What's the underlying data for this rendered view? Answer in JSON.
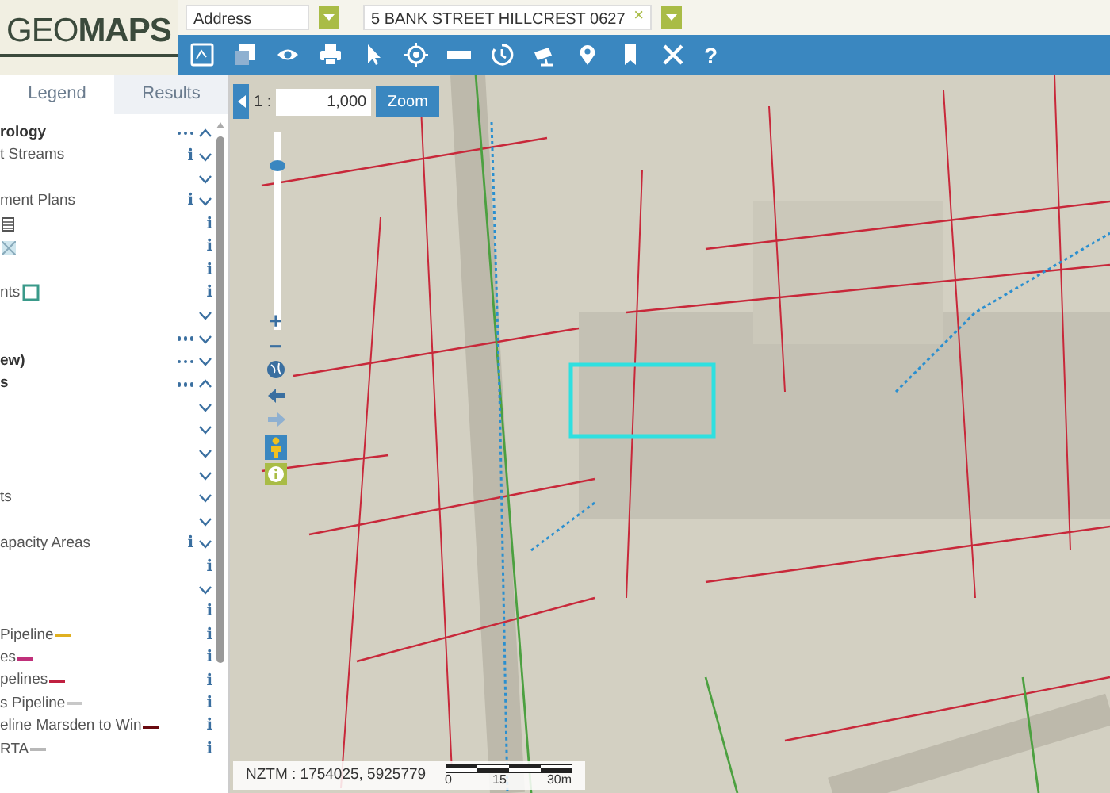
{
  "logo": "GEO**MAPS**",
  "search": {
    "type_value": "Address",
    "query": "5 BANK STREET HILLCREST 0627",
    "clear": "×"
  },
  "toolbar": {
    "help": "?"
  },
  "tabs": [
    {
      "label": "Legend",
      "selected": true
    },
    {
      "label": "Results",
      "selected": false
    }
  ],
  "legend": [
    {
      "label": "rology",
      "bold": true,
      "more": true,
      "expanded": true
    },
    {
      "label": "t Streams",
      "info": "i",
      "expanded": false
    },
    {
      "expanded": false
    },
    {
      "label": "ment Plans",
      "info": "i",
      "expanded": false
    },
    {
      "kind": "hatch",
      "info": "i"
    },
    {
      "kind": "cross",
      "info": "i"
    },
    {
      "info": "i"
    },
    {
      "label": "nts",
      "kind": "square",
      "info": "i"
    },
    {
      "expanded": false
    },
    {
      "more": true,
      "expanded": false
    },
    {
      "label": "ew)",
      "bold": true,
      "more": true,
      "expanded": false
    },
    {
      "label": "s",
      "bold": true,
      "more": true,
      "expanded": true
    },
    {
      "expanded": false
    },
    {
      "expanded": false
    },
    {
      "expanded": false
    },
    {
      "expanded": false
    },
    {
      "label": "ts",
      "expanded": false
    },
    {
      "expanded": false
    },
    {
      "label": "apacity Areas",
      "info": "i",
      "expanded": false
    },
    {
      "info": "i"
    },
    {
      "expanded": false
    },
    {
      "info": "i"
    },
    {
      "label": "Pipeline",
      "kind": "line",
      "color": "#e0b020",
      "info": "i"
    },
    {
      "label": "es",
      "kind": "line",
      "color": "#c0307a",
      "info": "i"
    },
    {
      "label": "pelines",
      "kind": "line",
      "color": "#c02040",
      "info": "i"
    },
    {
      "label": "s Pipeline",
      "kind": "line",
      "color": "#c8c8c8",
      "info": "i"
    },
    {
      "label": "eline Marsden to Win",
      "kind": "line",
      "color": "#6a0a10",
      "info": "i"
    },
    {
      "label": "RTA",
      "kind": "line",
      "color": "#b8b8b8",
      "info": "i"
    }
  ],
  "map": {
    "scale_prefix": "1 :",
    "scale_value": "1,000",
    "zoom_button": "Zoom",
    "zoom_slider": {
      "level": 0.85
    },
    "zoom_in": "+",
    "zoom_out": "−",
    "coordinates": "NZTM : 1754025, 5925779",
    "scale_bar": [
      "0",
      "15",
      "30m"
    ]
  }
}
